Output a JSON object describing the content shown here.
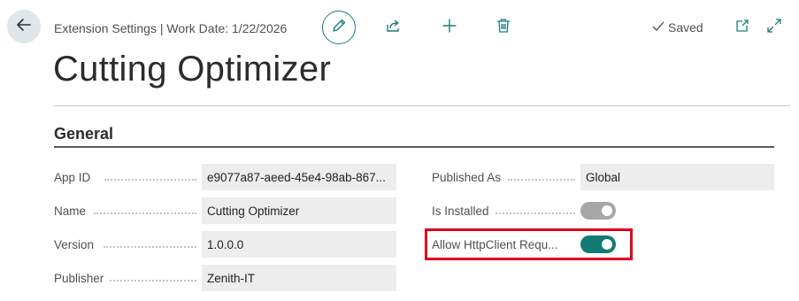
{
  "header": {
    "breadcrumb": "Extension Settings | Work Date: 1/22/2026",
    "saved_label": "Saved",
    "icons": [
      "back-arrow-icon",
      "edit-pencil-icon",
      "share-icon",
      "add-icon",
      "delete-icon",
      "checkmark-icon",
      "open-new-window-icon",
      "expand-icon"
    ]
  },
  "page": {
    "title": "Cutting Optimizer"
  },
  "general": {
    "section_title": "General",
    "app_id": {
      "label": "App ID",
      "value": "e9077a87-aeed-45e4-98ab-867..."
    },
    "name": {
      "label": "Name",
      "value": "Cutting Optimizer"
    },
    "version": {
      "label": "Version",
      "value": "1.0.0.0"
    },
    "publisher": {
      "label": "Publisher",
      "value": "Zenith-IT"
    },
    "published_as": {
      "label": "Published As",
      "value": "Global"
    },
    "is_installed": {
      "label": "Is Installed",
      "checked": true,
      "disabled": true
    },
    "allow_httpclient": {
      "label": "Allow HttpClient Requ...",
      "checked": true,
      "disabled": false
    }
  },
  "colors": {
    "accent": "#117a73",
    "highlight": "#e0001b",
    "field_bg": "#ededed"
  }
}
